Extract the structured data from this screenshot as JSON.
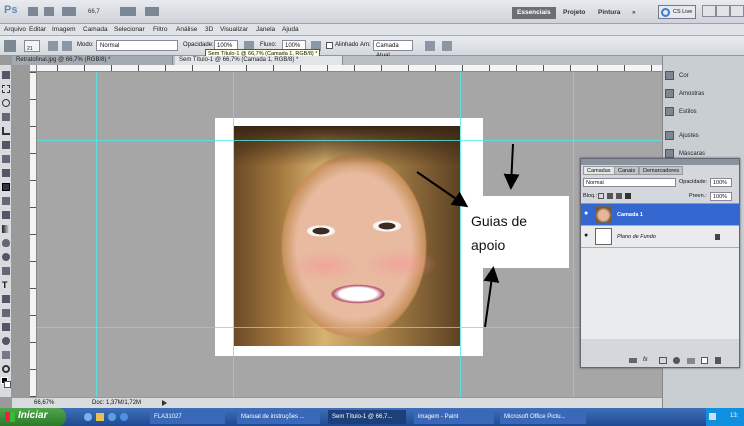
{
  "appbar": {
    "logo": "Ps",
    "zoom": "66,7",
    "workspaces": [
      "Essenciais",
      "Projeto",
      "Pintura"
    ],
    "more": "»",
    "cslive": "CS Live"
  },
  "menu": [
    "Arquivo",
    "Editar",
    "Imagem",
    "Camada",
    "Selecionar",
    "Filtro",
    "Análise",
    "3D",
    "Visualizar",
    "Janela",
    "Ajuda"
  ],
  "options": {
    "mode_label": "Modo:",
    "mode_value": "Normal",
    "opacity_label": "Opacidade:",
    "opacity_value": "100%",
    "flow_label": "Fluxo:",
    "flow_value": "100%",
    "aligned_label": "Alinhado",
    "sample_label": "Am:",
    "sample_value": "Camada Atual",
    "brush_size": "21"
  },
  "tabs": [
    "Retratofinal.jpg @ 66,7% (RGB/8) *",
    "Sem Título-1 @ 66,7% (Camada 1, RGB/8) *"
  ],
  "tooltip": "Sem Título-1 @ 66,7% (Camada 1, RGB/8) *",
  "annotation": {
    "line1": "Guias de",
    "line2": "apoio"
  },
  "status": {
    "zoom": "66,67%",
    "doc": "Doc: 1,37M/1,72M"
  },
  "dock": {
    "items": [
      "Cor",
      "Amostras",
      "Estilos",
      "Ajustes",
      "Máscaras"
    ]
  },
  "layers_panel": {
    "tabs": [
      "Camadas",
      "Canais",
      "Demarcadores"
    ],
    "blend_mode": "Normal",
    "opacity_label": "Opacidade:",
    "opacity_value": "100%",
    "lock_label": "Bloq.:",
    "fill_label": "Preen.:",
    "fill_value": "100%",
    "layers": [
      {
        "name": "Camada 1",
        "selected": true
      },
      {
        "name": "Plano de Fundo",
        "selected": false
      }
    ]
  },
  "taskbar": {
    "start": "Iniciar",
    "tasks": [
      "FLA31027",
      "Manual de instruções ...",
      "Sem Título-1 @ 66,7...",
      "imagem - Paint",
      "Microsoft Office Pictu..."
    ],
    "time": "13:"
  },
  "colors": {
    "accent": "#2d62c8",
    "guide": "#50ebeb",
    "selected_layer": "#3567d0"
  }
}
